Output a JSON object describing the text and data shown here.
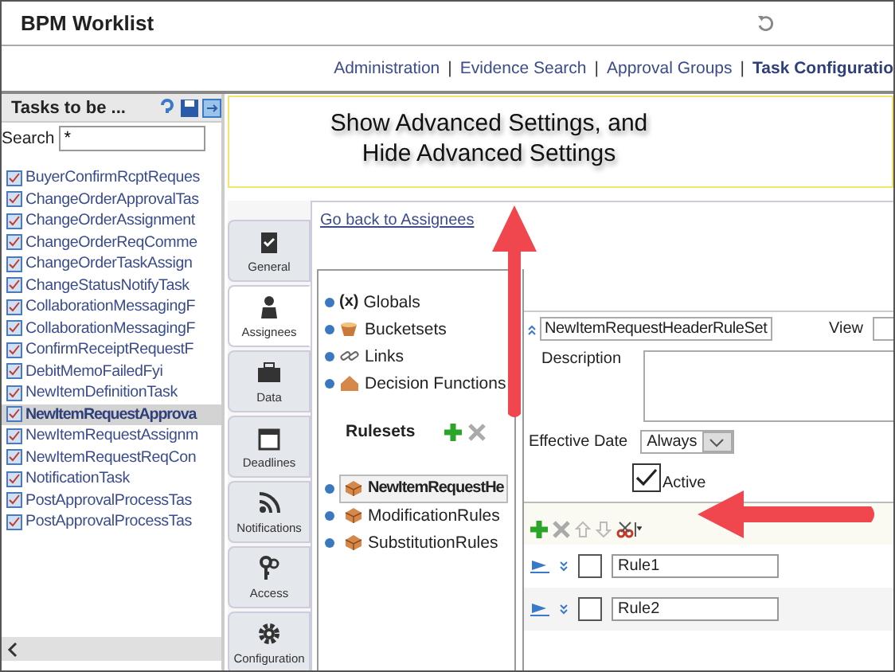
{
  "window": {
    "title": "BPM Worklist"
  },
  "nav_links": [
    {
      "label": "Administration",
      "selected": false
    },
    {
      "label": "Evidence Search",
      "selected": false,
      "separator": "|"
    },
    {
      "label": "Approval Groups",
      "selected": false,
      "separator": "|"
    },
    {
      "label": "Task Configuratio",
      "selected": true,
      "separator": "|"
    }
  ],
  "tasks_panel": {
    "title": "Tasks to be ...",
    "search_label": "Search",
    "search_value": "*",
    "items": [
      {
        "label": "BuyerConfirmRcptReques",
        "selected": false
      },
      {
        "label": "ChangeOrderApprovalTas",
        "selected": false
      },
      {
        "label": "ChangeOrderAssignment",
        "selected": false
      },
      {
        "label": "ChangeOrderReqComme",
        "selected": false
      },
      {
        "label": "ChangeOrderTaskAssign",
        "selected": false
      },
      {
        "label": "ChangeStatusNotifyTask",
        "selected": false
      },
      {
        "label": "CollaborationMessagingF",
        "selected": false
      },
      {
        "label": "CollaborationMessagingF",
        "selected": false
      },
      {
        "label": "ConfirmReceiptRequestF",
        "selected": false
      },
      {
        "label": "DebitMemoFailedFyi",
        "selected": false
      },
      {
        "label": "NewItemDefinitionTask",
        "selected": false
      },
      {
        "label": "NewItemRequestApprova",
        "selected": true
      },
      {
        "label": "NewItemRequestAssignm",
        "selected": false
      },
      {
        "label": "NewItemRequestReqCon",
        "selected": false
      },
      {
        "label": "NotificationTask",
        "selected": false
      },
      {
        "label": "PostApprovalProcessTas",
        "selected": false
      },
      {
        "label": "PostApprovalProcessTas",
        "selected": false
      }
    ]
  },
  "callout": {
    "lines": [
      "Show Advanced Settings, and",
      "Hide Advanced Settings"
    ]
  },
  "side_tabs": [
    {
      "label": "General",
      "kind": "clipboard",
      "selected": false
    },
    {
      "label": "Assignees",
      "kind": "person",
      "selected": true
    },
    {
      "label": "Data",
      "kind": "briefcase",
      "selected": false
    },
    {
      "label": "Deadlines",
      "kind": "calendar",
      "selected": false
    },
    {
      "label": "Notifications",
      "kind": "feed",
      "selected": false
    },
    {
      "label": "Access",
      "kind": "keys",
      "selected": false
    },
    {
      "label": "Configuration",
      "kind": "gear",
      "selected": false
    }
  ],
  "back_link": "Go back to Assignees",
  "dictionary_items": [
    {
      "label": "Globals",
      "kind": "variable",
      "symbol": "(x)"
    },
    {
      "label": "Bucketsets",
      "kind": "bucket"
    },
    {
      "label": "Links",
      "kind": "link"
    },
    {
      "label": "Decision Functions",
      "kind": "function"
    }
  ],
  "rulesets": {
    "title": "Rulesets",
    "items": [
      {
        "label": "NewItemRequestHe",
        "selected": true
      },
      {
        "label": "ModificationRules",
        "selected": false
      },
      {
        "label": "SubstitutionRules",
        "selected": false
      }
    ]
  },
  "ruleset_editor": {
    "name": "NewItemRequestHeaderRuleSet",
    "view_label": "View",
    "description_label": "Description",
    "effective_date_label": "Effective Date",
    "effective_date": "Always",
    "active": true,
    "active_label": "Active"
  },
  "rules": [
    {
      "name": "Rule1",
      "checked": false
    },
    {
      "name": "Rule2",
      "checked": false
    }
  ]
}
